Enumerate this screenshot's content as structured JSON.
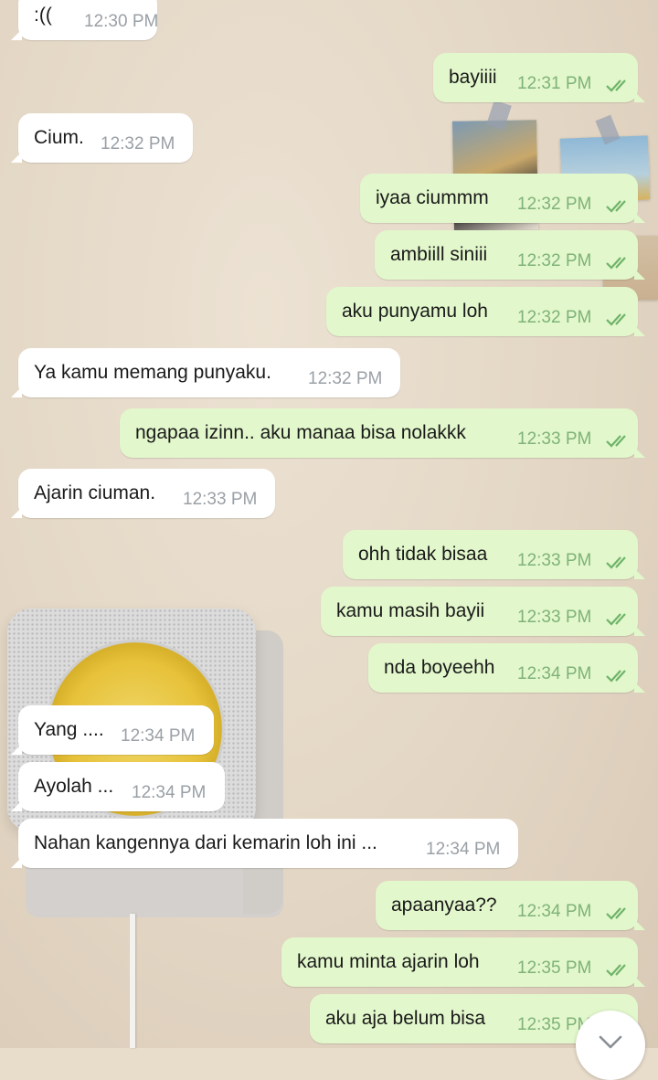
{
  "colors": {
    "incoming_bubble": "#ffffff",
    "outgoing_bubble": "#e2f7cb",
    "timestamp_in": "#9aa0a6",
    "timestamp_out": "#7fb279",
    "read_ticks": "#6fb36a"
  },
  "messages": [
    {
      "text": ":((",
      "time": "12:30 PM",
      "dir": "in"
    },
    {
      "text": "bayiiii",
      "time": "12:31 PM",
      "dir": "out",
      "status": "read"
    },
    {
      "text": "Cium.",
      "time": "12:32 PM",
      "dir": "in"
    },
    {
      "text": "iyaa ciummm",
      "time": "12:32 PM",
      "dir": "out",
      "status": "read"
    },
    {
      "text": "ambiill siniii",
      "time": "12:32 PM",
      "dir": "out",
      "status": "read"
    },
    {
      "text": "aku punyamu loh",
      "time": "12:32 PM",
      "dir": "out",
      "status": "read"
    },
    {
      "text": "Ya kamu memang punyaku.",
      "time": "12:32 PM",
      "dir": "in"
    },
    {
      "text": "ngapaa izinn.. aku manaa bisa nolakkk",
      "time": "12:33 PM",
      "dir": "out",
      "status": "read"
    },
    {
      "text": "Ajarin ciuman.",
      "time": "12:33 PM",
      "dir": "in"
    },
    {
      "text": "ohh tidak bisaa",
      "time": "12:33 PM",
      "dir": "out",
      "status": "read"
    },
    {
      "text": "kamu masih bayii",
      "time": "12:33 PM",
      "dir": "out",
      "status": "read"
    },
    {
      "text": "nda boyeehh",
      "time": "12:34 PM",
      "dir": "out",
      "status": "read"
    },
    {
      "text": "Yang ....",
      "time": "12:34 PM",
      "dir": "in"
    },
    {
      "text": "Ayolah ...",
      "time": "12:34 PM",
      "dir": "in"
    },
    {
      "text": "Nahan kangennya dari kemarin loh ini ...",
      "time": "12:34 PM",
      "dir": "in"
    },
    {
      "text": "apaanyaa??",
      "time": "12:34 PM",
      "dir": "out",
      "status": "read"
    },
    {
      "text": "kamu minta ajarin loh",
      "time": "12:35 PM",
      "dir": "out",
      "status": "read"
    },
    {
      "text": "aku aja belum bisa",
      "time": "12:35 PM",
      "dir": "out",
      "status": "read"
    }
  ],
  "scroll_button": {
    "icon": "chevron-down-icon"
  }
}
